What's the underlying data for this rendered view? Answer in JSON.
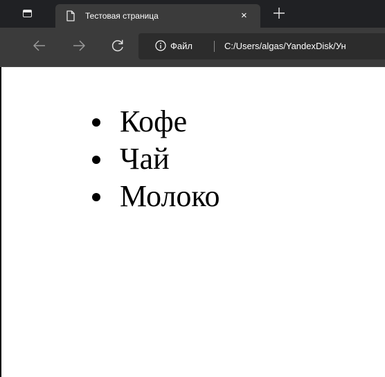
{
  "tab": {
    "title": "Тестовая страница",
    "close_glyph": "×"
  },
  "toolbar": {
    "address": {
      "file_label": "Файл",
      "url": "C:/Users/algas/YandexDisk/Ун"
    }
  },
  "page": {
    "list_items": [
      "Кофе",
      "Чай",
      "Молоко"
    ]
  },
  "icons": {
    "tab_actions": "tab-actions-icon",
    "page": "page-icon",
    "new_tab": "plus-icon",
    "back": "arrow-left-icon",
    "forward": "arrow-right-icon",
    "refresh": "refresh-icon",
    "info": "info-icon"
  },
  "colors": {
    "tabstrip_bg": "#202124",
    "toolbar_bg": "#3b3b3b",
    "address_bg": "#2c2c2c",
    "text_light": "#ffffff",
    "page_bg": "#ffffff"
  }
}
